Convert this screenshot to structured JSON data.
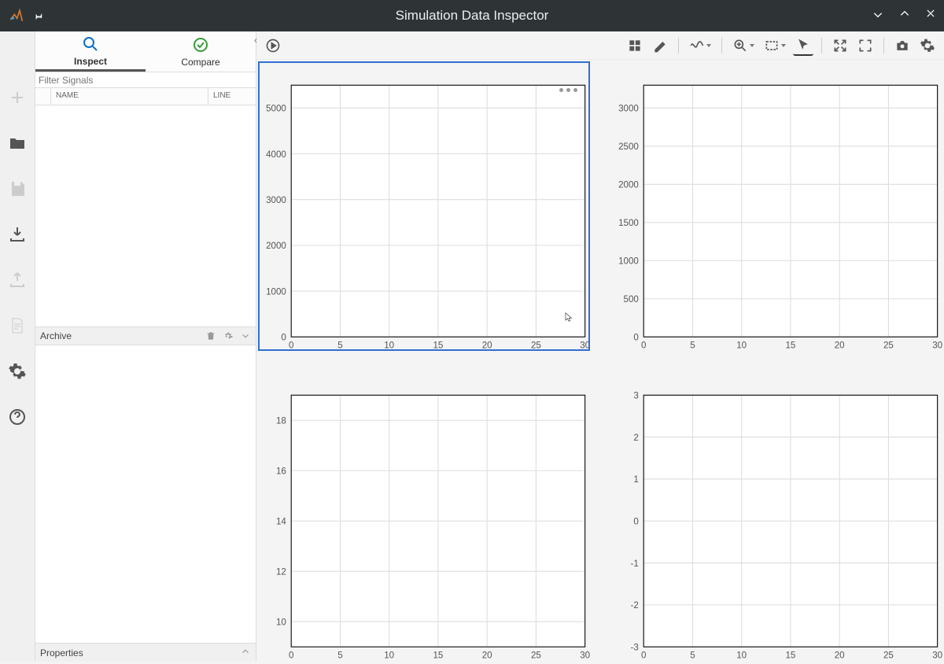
{
  "window": {
    "title": "Simulation Data Inspector"
  },
  "tabs": {
    "inspect": "Inspect",
    "compare": "Compare"
  },
  "filter": {
    "placeholder": "Filter Signals"
  },
  "table_headers": {
    "name": "NAME",
    "line": "LINE"
  },
  "sections": {
    "archive": "Archive",
    "properties": "Properties"
  },
  "toolbar_icons": {
    "play": "play-icon",
    "layout": "layout-grid-icon",
    "clear": "eraser-icon",
    "signal": "signal-icon",
    "zoom": "zoom-icon",
    "box": "box-select-icon",
    "pointer": "pointer-icon",
    "expand": "expand-icon",
    "fullscreen": "fullscreen-icon",
    "camera": "camera-icon",
    "settings": "gear-icon"
  },
  "chart_data": [
    {
      "type": "empty-axes",
      "position": "top-left",
      "selected": true,
      "x": {
        "ticks": [
          0,
          5,
          10,
          15,
          20,
          25,
          30
        ],
        "range": [
          0,
          30
        ]
      },
      "y": {
        "ticks": [
          0,
          1000,
          2000,
          3000,
          4000,
          5000
        ],
        "range": [
          0,
          5500
        ]
      }
    },
    {
      "type": "empty-axes",
      "position": "top-right",
      "selected": false,
      "x": {
        "ticks": [
          0,
          5,
          10,
          15,
          20,
          25,
          30
        ],
        "range": [
          0,
          30
        ]
      },
      "y": {
        "ticks": [
          0,
          500,
          1000,
          1500,
          2000,
          2500,
          3000
        ],
        "range": [
          0,
          3300
        ]
      }
    },
    {
      "type": "empty-axes",
      "position": "bottom-left",
      "selected": false,
      "x": {
        "ticks": [
          0,
          5,
          10,
          15,
          20,
          25,
          30
        ],
        "range": [
          0,
          30
        ]
      },
      "y": {
        "ticks": [
          10,
          12,
          14,
          16,
          18
        ],
        "range": [
          9,
          19
        ]
      }
    },
    {
      "type": "empty-axes",
      "position": "bottom-right",
      "selected": false,
      "x": {
        "ticks": [
          0,
          5,
          10,
          15,
          20,
          25,
          30
        ],
        "range": [
          0,
          30
        ]
      },
      "y": {
        "ticks": [
          -3,
          -2,
          -1,
          0,
          1,
          2,
          3
        ],
        "range": [
          -3,
          3
        ]
      }
    }
  ]
}
